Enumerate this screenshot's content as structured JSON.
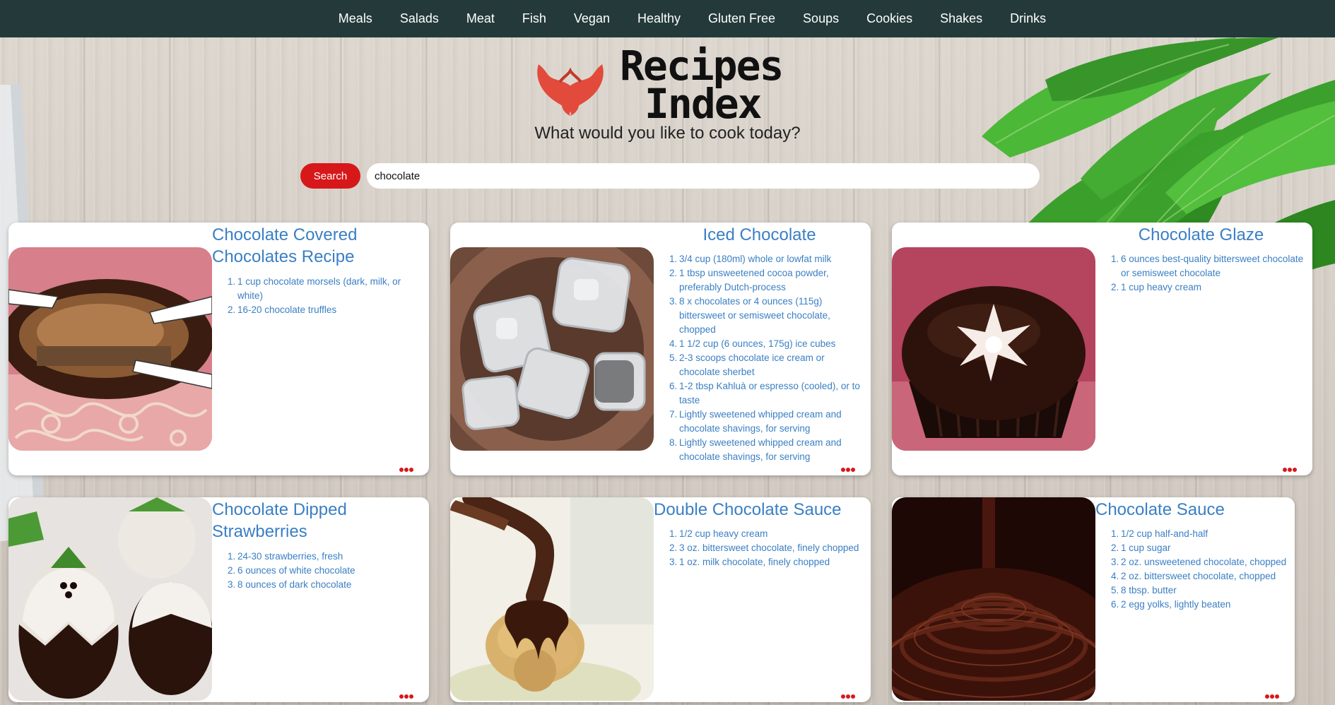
{
  "nav": {
    "items": [
      "Meals",
      "Salads",
      "Meat",
      "Fish",
      "Vegan",
      "Healthy",
      "Gluten Free",
      "Soups",
      "Cookies",
      "Shakes",
      "Drinks"
    ]
  },
  "logo": {
    "line1": "Recipes",
    "line2": "Index"
  },
  "tagline": "What would you like to cook today?",
  "search": {
    "button_label": "Search",
    "value": "chocolate"
  },
  "recipes": [
    {
      "title": "Chocolate Covered Chocolates Recipe",
      "ingredients": [
        "1 cup chocolate morsels (dark, milk, or white)",
        "16-20 chocolate truffles"
      ]
    },
    {
      "title": "Iced Chocolate",
      "ingredients": [
        "3/4 cup (180ml) whole or lowfat milk",
        "1 tbsp unsweetened cocoa powder, preferably Dutch-process",
        "8 x chocolates or 4 ounces (115g) bittersweet or semisweet chocolate, chopped",
        "1 1/2 cup (6 ounces, 175g) ice cubes",
        "2-3 scoops chocolate ice cream or chocolate sherbet",
        "1-2 tbsp Kahluà or espresso (cooled), or to taste",
        "Lightly sweetened whipped cream and chocolate shavings, for serving",
        "Lightly sweetened whipped cream and chocolate shavings, for serving"
      ]
    },
    {
      "title": "Chocolate Glaze",
      "ingredients": [
        "6 ounces best-quality bittersweet chocolate or semisweet chocolate",
        "1 cup heavy cream"
      ]
    },
    {
      "title": "Chocolate Dipped Strawberries",
      "ingredients": [
        "24-30 strawberries, fresh",
        "6 ounces of white chocolate",
        "8 ounces of dark chocolate"
      ]
    },
    {
      "title": "Double Chocolate Sauce",
      "ingredients": [
        "1/2 cup heavy cream",
        "3 oz. bittersweet chocolate, finely chopped",
        "1 oz. milk chocolate, finely chopped"
      ]
    },
    {
      "title": "Chocolate Sauce",
      "ingredients": [
        "1/2 cup half-and-half",
        "1 cup sugar",
        "2 oz. unsweetened chocolate, chopped",
        "2 oz. bittersweet chocolate, chopped",
        "8 tbsp. butter",
        "2 egg yolks, lightly beaten"
      ]
    }
  ],
  "icons": {
    "more": "more-dots-icon",
    "logo": "chili-peppers-icon"
  },
  "colors": {
    "nav_bg": "#243a3a",
    "accent_red": "#d7181a",
    "title_blue": "#3a7fc4"
  }
}
